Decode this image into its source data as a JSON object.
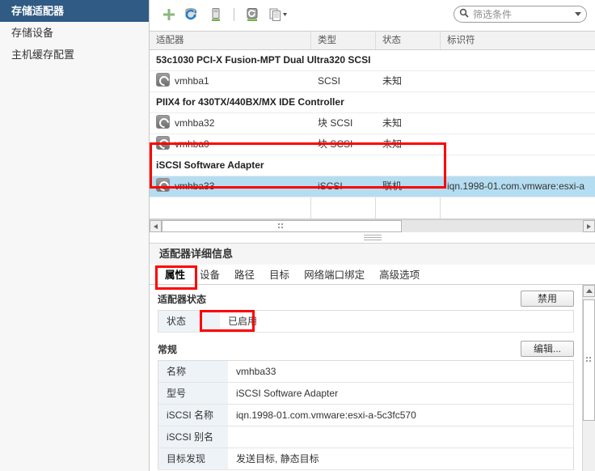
{
  "sidebar": {
    "items": [
      {
        "label": "存储适配器",
        "active": true
      },
      {
        "label": "存储设备",
        "active": false
      },
      {
        "label": "主机缓存配置",
        "active": false
      }
    ]
  },
  "toolbar": {
    "icons": [
      {
        "name": "add-software-adapter-icon",
        "glyph": "+"
      },
      {
        "name": "rescan-storage-icon",
        "glyph": ""
      },
      {
        "name": "rescan-adapter-icon",
        "glyph": ""
      },
      {
        "name": "refresh-adapter-icon",
        "glyph": ""
      },
      {
        "name": "copy-actions-icon",
        "glyph": ""
      }
    ],
    "filter_placeholder": "筛选条件"
  },
  "adapters_table": {
    "columns": [
      "适配器",
      "类型",
      "状态",
      "标识符"
    ],
    "groups": [
      {
        "group_label": "53c1030 PCI-X Fusion-MPT Dual Ultra320 SCSI",
        "rows": [
          {
            "adapter": "vmhba1",
            "type": "SCSI",
            "status": "未知",
            "identifier": ""
          }
        ]
      },
      {
        "group_label": "PIIX4 for 430TX/440BX/MX IDE Controller",
        "rows": [
          {
            "adapter": "vmhba32",
            "type": "块 SCSI",
            "status": "未知",
            "identifier": ""
          },
          {
            "adapter": "vmhba0",
            "type": "块 SCSI",
            "status": "未知",
            "identifier": ""
          }
        ]
      },
      {
        "group_label": "iSCSI Software Adapter",
        "rows": [
          {
            "adapter": "vmhba33",
            "type": "iSCSI",
            "status": "联机",
            "identifier": "iqn.1998-01.com.vmware:esxi-a",
            "selected": true
          }
        ]
      }
    ]
  },
  "details": {
    "title": "适配器详细信息",
    "tabs": [
      {
        "label": "属性",
        "active": true
      },
      {
        "label": "设备",
        "active": false
      },
      {
        "label": "路径",
        "active": false
      },
      {
        "label": "目标",
        "active": false
      },
      {
        "label": "网络端口绑定",
        "active": false
      },
      {
        "label": "高级选项",
        "active": false
      }
    ],
    "adapter_status": {
      "section_label": "适配器状态",
      "button_label": "禁用",
      "rows": [
        {
          "key": "状态",
          "value": "已启用"
        }
      ]
    },
    "general": {
      "section_label": "常规",
      "button_label": "编辑...",
      "rows": [
        {
          "key": "名称",
          "value": "vmhba33"
        },
        {
          "key": "型号",
          "value": "iSCSI Software Adapter"
        },
        {
          "key": "iSCSI 名称",
          "value": "iqn.1998-01.com.vmware:esxi-a-5c3fc570"
        },
        {
          "key": "iSCSI 别名",
          "value": ""
        },
        {
          "key": "目标发现",
          "value": "发送目标, 静态目标"
        }
      ]
    }
  },
  "colors": {
    "sidebar_active": "#2f5b84",
    "row_selected": "#b5ddf2",
    "annotation": "#ff0000"
  }
}
